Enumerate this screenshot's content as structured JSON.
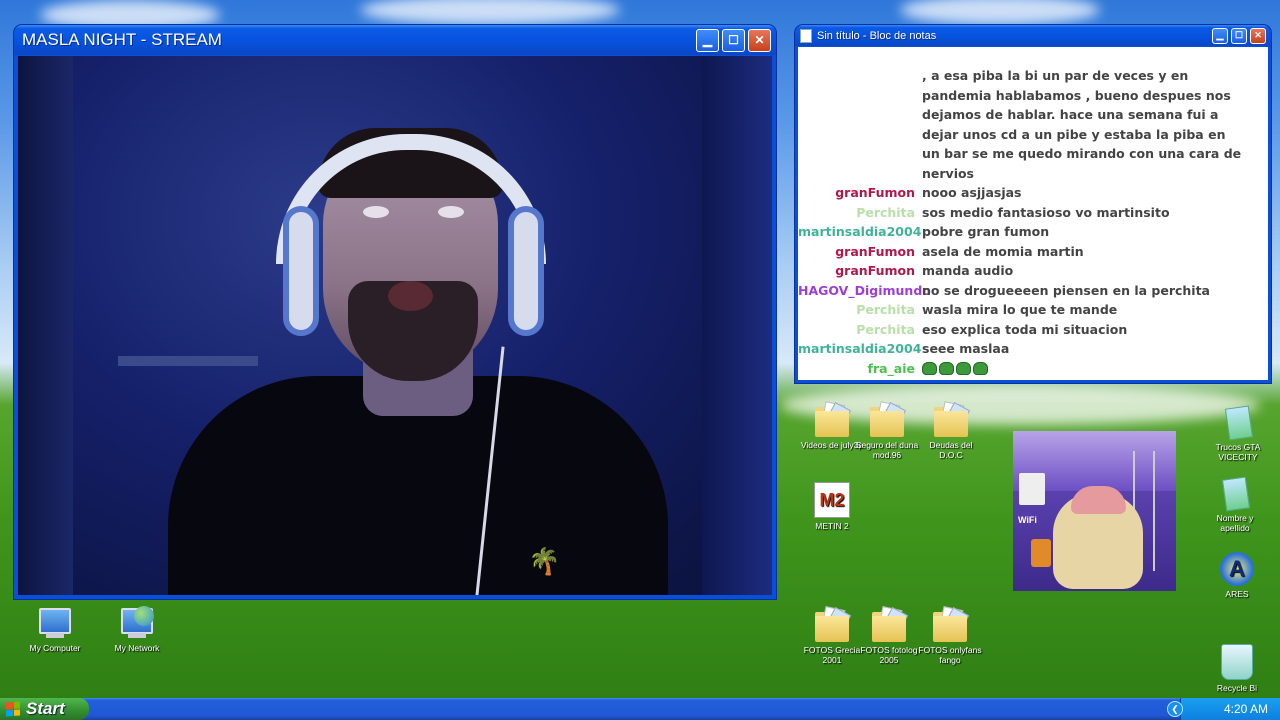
{
  "stream_window": {
    "title": "MASLA NIGHT - STREAM"
  },
  "notepad_window": {
    "title": "Sin título - Bloc de notas",
    "messages": [
      {
        "user": "",
        "text": ", a esa piba la bi un par de veces y en",
        "color": "#444444"
      },
      {
        "user": "",
        "text": "pandemia hablabamos , bueno despues nos",
        "color": "#444444"
      },
      {
        "user": "",
        "text": "dejamos de hablar. hace una semana fui a",
        "color": "#444444"
      },
      {
        "user": "",
        "text": "dejar unos cd a un pibe y estaba la piba en",
        "color": "#444444"
      },
      {
        "user": "",
        "text": "un bar se me quedo mirando con una cara de",
        "color": "#444444"
      },
      {
        "user": "",
        "text": "nervios",
        "color": "#444444"
      },
      {
        "user": "granFumon",
        "text": "nooo asjjasjas",
        "color": "#b0174a"
      },
      {
        "user": "Perchita",
        "text": "sos medio fantasioso vo martinsito",
        "color": "#b8e0a8"
      },
      {
        "user": "martinsaldia2004",
        "text": "pobre gran fumon",
        "color": "#3fb39a"
      },
      {
        "user": "granFumon",
        "text": "asela de momia martin",
        "color": "#b0174a"
      },
      {
        "user": "granFumon",
        "text": "manda audio",
        "color": "#b0174a"
      },
      {
        "user": "HAGOV_Digimundo",
        "text": "no se drogueeeen piensen en la perchita",
        "color": "#9b3fd6"
      },
      {
        "user": "Perchita",
        "text": "wasla mira lo que te mande",
        "color": "#b8e0a8"
      },
      {
        "user": "Perchita",
        "text": "eso explica toda mi situacion",
        "color": "#b8e0a8"
      },
      {
        "user": "martinsaldia2004",
        "text": "seee maslaa",
        "color": "#3fb39a"
      },
      {
        "user": "fra_aie",
        "text": "",
        "color": "#4ec04e",
        "emotes": 4
      }
    ]
  },
  "desktop_icons": {
    "my_computer": "My Computer",
    "my_network": "My Network",
    "videos": "Videos de july3p",
    "seguro": "Seguro del duna mod.96",
    "deudas": "Deudas del D.O.C",
    "metin": "METIN 2",
    "fotos_grecia": "FOTOS Grecia 2001",
    "fotos_fotolog": "FOTOS fotolog 2005",
    "fotos_onlyfans": "FOTOS onlyfans fango",
    "trucos": "Trucos GTA VICECITY",
    "nombre": "Nombre y apellido",
    "ares": "ARES",
    "recycle": "Recycle Bi"
  },
  "meme": {
    "wifi_label": "WiFi"
  },
  "taskbar": {
    "start_label": "Start",
    "clock": "4:20 AM"
  },
  "colors": {
    "title_blue": "#0751dc",
    "start_green": "#338d2e",
    "tray_blue": "#0f7fe0"
  }
}
